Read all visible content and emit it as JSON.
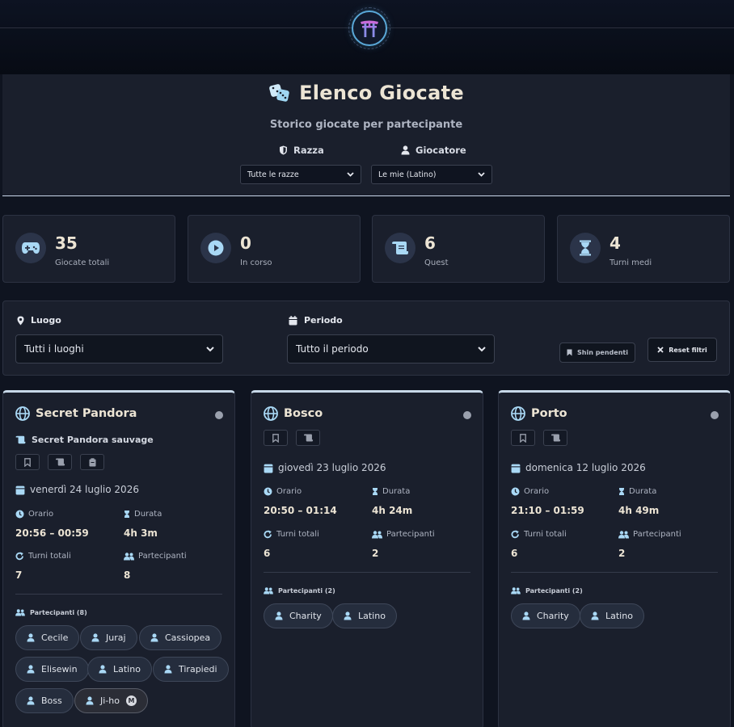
{
  "header": {
    "title": "Elenco Giocate",
    "subtitle": "Storico giocate per partecipante",
    "race_label": "Razza",
    "race_select": "Tutte le razze",
    "player_label": "Giocatore",
    "player_select": "Le mie (Latino)"
  },
  "stats": [
    {
      "value": "35",
      "label": "Giocate totali",
      "icon": "gamepad-icon"
    },
    {
      "value": "0",
      "label": "In corso",
      "icon": "play-icon"
    },
    {
      "value": "6",
      "label": "Quest",
      "icon": "scroll-icon"
    },
    {
      "value": "4",
      "label": "Turni medi",
      "icon": "hourglass-icon"
    }
  ],
  "filters": {
    "place_label": "Luogo",
    "place_value": "Tutti i luoghi",
    "period_label": "Periodo",
    "period_value": "Tutto il periodo",
    "pending_button": "Shin pendenti",
    "reset_button": "Reset filtri"
  },
  "labels": {
    "orario": "Orario",
    "durata": "Durata",
    "turni": "Turni totali",
    "partecipanti": "Partecipanti"
  },
  "cards": [
    {
      "title": "Secret Pandora",
      "quest": "Secret Pandora sauvage",
      "date": "venerdì 24 luglio 2026",
      "orario": "20:56 – 00:59",
      "durata": "4h 3m",
      "turni": "7",
      "partecipanti": "8",
      "participants_heading": "Partecipanti (8)",
      "participants": [
        "Cecile",
        "Juraj",
        "Cassiopea",
        "Elisewin",
        "Latino",
        "Tirapiedi",
        "Boss",
        "Ji-ho"
      ],
      "master_badge": "M"
    },
    {
      "title": "Bosco",
      "date": "giovedì 23 luglio 2026",
      "orario": "20:50 – 01:14",
      "durata": "4h 24m",
      "turni": "6",
      "partecipanti": "2",
      "participants_heading": "Partecipanti (2)",
      "participants": [
        "Charity",
        "Latino"
      ]
    },
    {
      "title": "Porto",
      "date": "domenica 12 luglio 2026",
      "orario": "21:10 – 01:59",
      "durata": "4h 49m",
      "turni": "6",
      "partecipanti": "2",
      "participants_heading": "Partecipanti (2)",
      "participants": [
        "Charity",
        "Latino"
      ]
    }
  ],
  "colors": {
    "background": "#0f1420",
    "panel": "#1a1f2c",
    "accent": "#7ec8f0",
    "title": "#ece4d4"
  }
}
